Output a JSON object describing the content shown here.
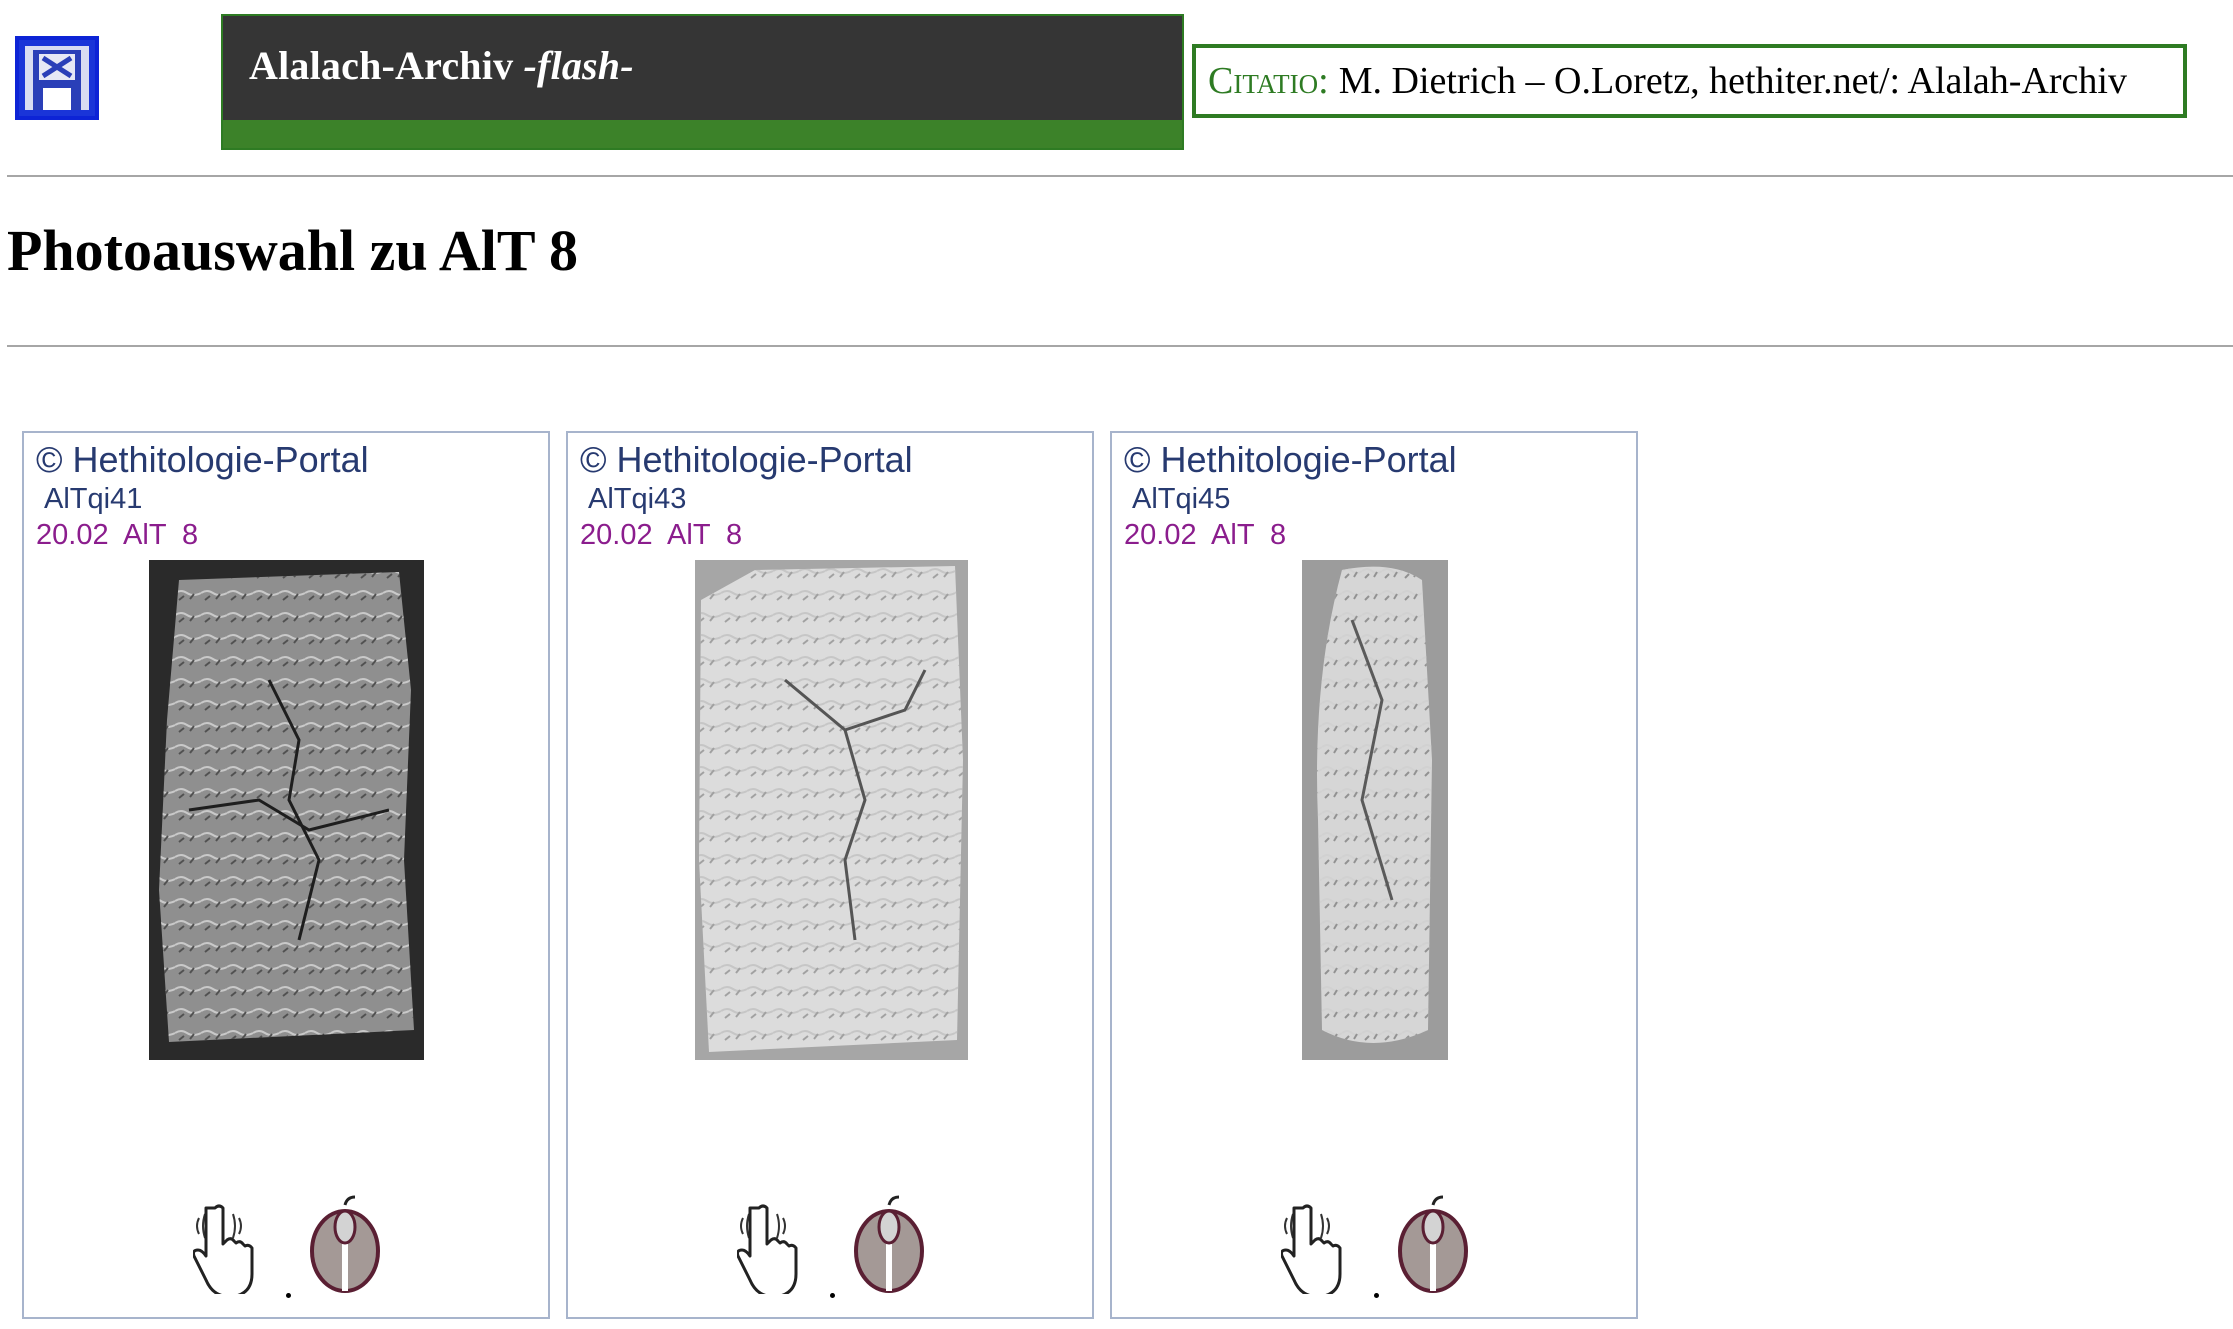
{
  "header": {
    "banner_title_main": "Alalach-Archiv",
    "banner_title_flash": "-flash-",
    "citatio_label": "Citatio:",
    "citatio_text": "M. Dietrich – O.Loretz, hethiter.net/: Alalah-Archiv",
    "home_icon": "home-gate-icon"
  },
  "page": {
    "title": "Photoauswahl zu AlT 8"
  },
  "cards": [
    {
      "copyright": "© Hethitologie-Portal",
      "id": "AlTqi41",
      "ref": "20.02  AlT  8",
      "photo_tone": "dark",
      "touch_icon": "touch-hand-icon",
      "mouse_icon": "mouse-icon"
    },
    {
      "copyright": "© Hethitologie-Portal",
      "id": "AlTqi43",
      "ref": "20.02  AlT  8",
      "photo_tone": "light",
      "touch_icon": "touch-hand-icon",
      "mouse_icon": "mouse-icon"
    },
    {
      "copyright": "© Hethitologie-Portal",
      "id": "AlTqi45",
      "ref": "20.02  AlT  8",
      "photo_tone": "edge",
      "touch_icon": "touch-hand-icon",
      "mouse_icon": "mouse-icon"
    }
  ],
  "colors": {
    "banner_bg": "#353535",
    "banner_green": "#3c8229",
    "citatio_border": "#2e7b23",
    "home_border": "#0d24d6",
    "card_border": "#a7b4cc",
    "card_text": "#273a70",
    "card_ref": "#8b1d8d"
  }
}
